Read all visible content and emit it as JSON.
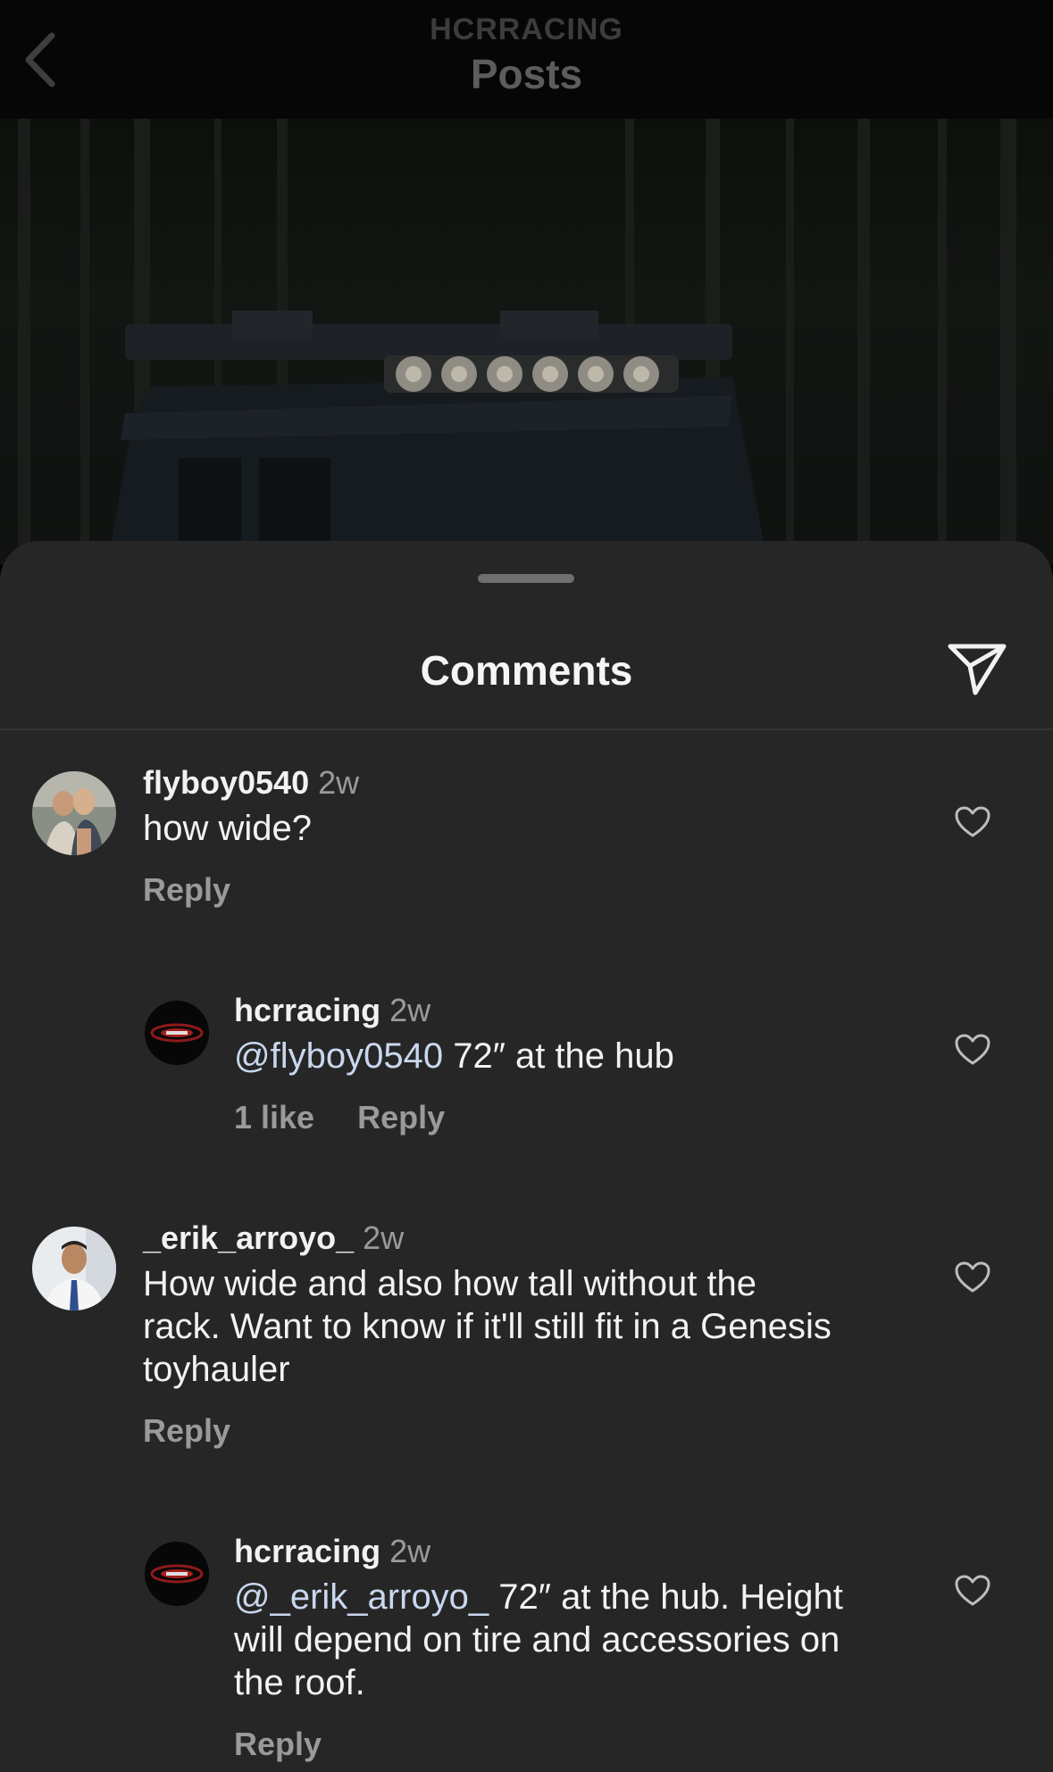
{
  "header": {
    "account": "HCRRACING",
    "title": "Posts"
  },
  "sheet": {
    "title": "Comments"
  },
  "comments": [
    {
      "username": "flyboy0540",
      "time": "2w",
      "text": "how wide?",
      "reply_label": "Reply"
    },
    {
      "username": "hcrracing",
      "time": "2w",
      "mention": "@flyboy0540",
      "text": " 72″ at the hub",
      "likes": "1 like",
      "reply_label": "Reply"
    },
    {
      "username": "_erik_arroyo_",
      "time": "2w",
      "text_lines": [
        "How wide and also how tall without the",
        "rack. Want to know if it'll still fit in a Genesis",
        "toyhauler"
      ],
      "reply_label": "Reply"
    },
    {
      "username": "hcrracing",
      "time": "2w",
      "mention": "@_erik_arroyo_",
      "text_lines": [
        " 72″ at the hub. Height",
        "will depend on tire and accessories on",
        "the roof."
      ],
      "reply_label": "Reply"
    }
  ]
}
